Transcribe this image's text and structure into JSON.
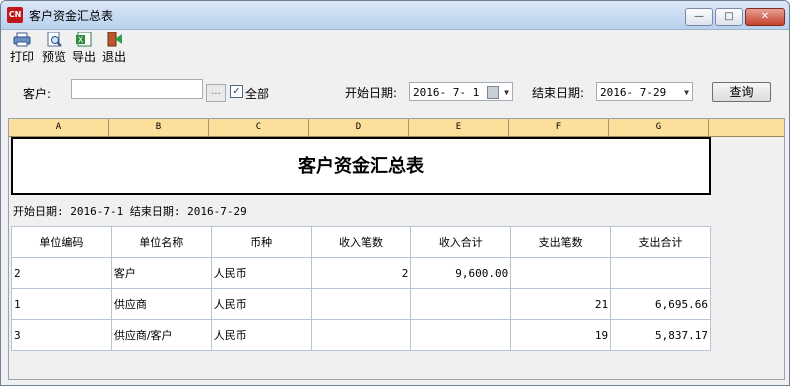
{
  "window": {
    "icon_text": "CN",
    "title": "客户资金汇总表",
    "minimize": "—",
    "maximize": "□",
    "close": "✕"
  },
  "toolbar": {
    "print": "打印",
    "preview": "预览",
    "export": "导出",
    "exit": "退出"
  },
  "form": {
    "customer_label": "客户:",
    "customer_value": "",
    "browse": "...",
    "all_checked": "✓",
    "all_label": "全部",
    "start_label": "开始日期:",
    "start_value": "2016- 7- 1",
    "end_label": "结束日期:",
    "end_value": "2016- 7-29",
    "query": "查询"
  },
  "sheet": {
    "columns": [
      "A",
      "B",
      "C",
      "D",
      "E",
      "F",
      "G"
    ],
    "report_title": "客户资金汇总表",
    "date_range": "开始日期: 2016-7-1 结束日期: 2016-7-29",
    "headers": [
      "单位编码",
      "单位名称",
      "币种",
      "收入笔数",
      "收入合计",
      "支出笔数",
      "支出合计"
    ],
    "rows": [
      [
        "2",
        "客户",
        "人民币",
        "2",
        "9,600.00",
        "",
        ""
      ],
      [
        "1",
        "供应商",
        "人民币",
        "",
        "",
        "21",
        "6,695.66"
      ],
      [
        "3",
        "供应商/客户",
        "人民币",
        "",
        "",
        "19",
        "5,837.17"
      ]
    ]
  },
  "colors": {
    "title_bar": "#c4d8f0",
    "col_header": "#fbdf9a",
    "close_button": "#c3432d"
  },
  "icons": [
    "app-logo-icon",
    "printer-icon",
    "preview-icon",
    "excel-export-icon",
    "exit-door-icon",
    "calendar-icon",
    "dropdown-arrow-icon"
  ]
}
